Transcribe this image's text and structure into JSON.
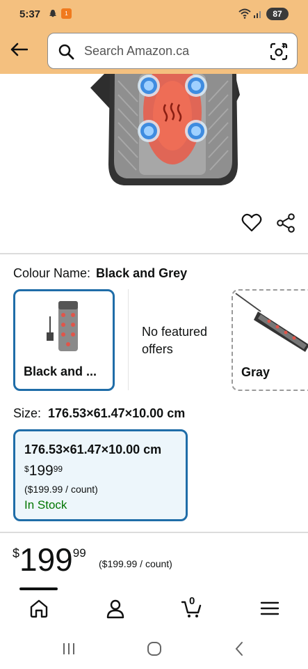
{
  "status_bar": {
    "time": "5:37",
    "battery": "87",
    "notification_icon_text": "1"
  },
  "search": {
    "placeholder": "Search Amazon.ca",
    "icons": [
      "back-arrow-icon",
      "search-icon",
      "camera-icon"
    ]
  },
  "colors": {
    "header_bg": "#f4c07f",
    "accent_blue": "#1f6da8",
    "selected_bg": "#edf6fb",
    "in_stock_green": "#007600"
  },
  "colour": {
    "label": "Colour Name:",
    "value": "Black and Grey",
    "options": [
      {
        "label": "Black and ...",
        "selected": true
      },
      {
        "label": "No featured offers",
        "selected": false
      },
      {
        "label": "Gray",
        "selected": false
      }
    ]
  },
  "size": {
    "label": "Size:",
    "value": "176.53×61.47×10.00 cm",
    "option": {
      "title": "176.53×61.47×10.00 cm",
      "price_currency": "$",
      "price_whole": "199",
      "price_fraction": "99",
      "unit_price": "($199.99 / count)",
      "stock": "In Stock"
    }
  },
  "price": {
    "currency": "$",
    "whole": "199",
    "fraction": "99",
    "unit_price": "($199.99 / count)"
  },
  "bottom_nav": {
    "cart_count": "0",
    "items": [
      "home-icon",
      "account-icon",
      "cart-icon",
      "menu-icon"
    ]
  }
}
